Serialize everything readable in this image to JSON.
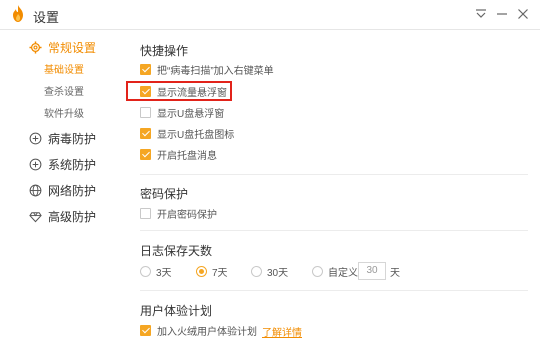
{
  "window": {
    "title": "设置",
    "accent_color": "#f28c00",
    "controls": [
      "menu-icon",
      "minimize-icon",
      "close-icon"
    ]
  },
  "sidebar": {
    "items": [
      {
        "label": "常规设置",
        "icon": "gear-icon",
        "active": true
      },
      {
        "label": "病毒防护",
        "icon": "plus-circle-icon",
        "active": false
      },
      {
        "label": "系统防护",
        "icon": "plus-circle-icon",
        "active": false
      },
      {
        "label": "网络防护",
        "icon": "globe-icon",
        "active": false
      },
      {
        "label": "高级防护",
        "icon": "diamond-icon",
        "active": false
      }
    ],
    "subitems": [
      {
        "label": "基础设置",
        "active": true
      },
      {
        "label": "查杀设置",
        "active": false
      },
      {
        "label": "软件升级",
        "active": false
      }
    ]
  },
  "content": {
    "quick_ops": {
      "title": "快捷操作",
      "options": [
        {
          "label": "把“病毒扫描”加入右键菜单",
          "checked": true
        },
        {
          "label": "显示流量悬浮窗",
          "checked": true
        },
        {
          "label": "显示U盘悬浮窗",
          "checked": false
        },
        {
          "label": "显示U盘托盘图标",
          "checked": true
        },
        {
          "label": "开启托盘消息",
          "checked": true
        }
      ]
    },
    "password": {
      "title": "密码保护",
      "options": [
        {
          "label": "开启密码保护",
          "checked": false
        }
      ]
    },
    "log_days": {
      "title": "日志保存天数",
      "options": [
        {
          "label": "3天",
          "checked": false
        },
        {
          "label": "7天",
          "checked": true
        },
        {
          "label": "30天",
          "checked": false
        },
        {
          "label": "自定义",
          "checked": false
        }
      ],
      "custom_value": "30",
      "unit": "天"
    },
    "ux_plan": {
      "title": "用户体验计划",
      "option": {
        "label": "加入火绒用户体验计划",
        "checked": true
      },
      "link": "了解详情"
    }
  }
}
